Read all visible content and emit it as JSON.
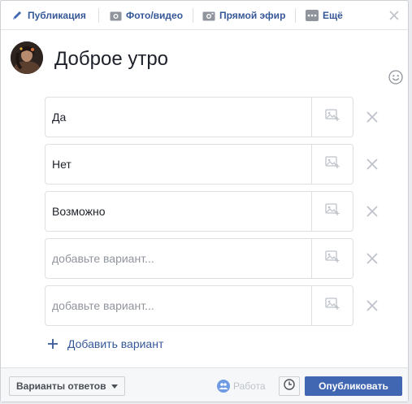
{
  "tabs": [
    {
      "label": "Публикация",
      "icon": "pencil-icon"
    },
    {
      "label": "Фото/видео",
      "icon": "camera-icon"
    },
    {
      "label": "Прямой эфир",
      "icon": "video-camera-icon"
    },
    {
      "label": "Ещё",
      "icon": "more-dots-icon"
    }
  ],
  "post": {
    "text": "Доброе утро"
  },
  "options": [
    {
      "value": "Да",
      "placeholder": "добавьте вариант..."
    },
    {
      "value": "Нет",
      "placeholder": "добавьте вариант..."
    },
    {
      "value": "Возможно",
      "placeholder": "добавьте вариант..."
    },
    {
      "value": "",
      "placeholder": "добавьте вариант..."
    },
    {
      "value": "",
      "placeholder": "добавьте вариант..."
    }
  ],
  "add_option_label": "Добавить вариант",
  "footer": {
    "answers_label": "Варианты ответов",
    "audience_label": "Работа",
    "publish_label": "Опубликовать"
  },
  "colors": {
    "accent": "#4267b2",
    "link": "#365899",
    "border": "#dddfe2",
    "footer_bg": "#f6f7f9"
  }
}
